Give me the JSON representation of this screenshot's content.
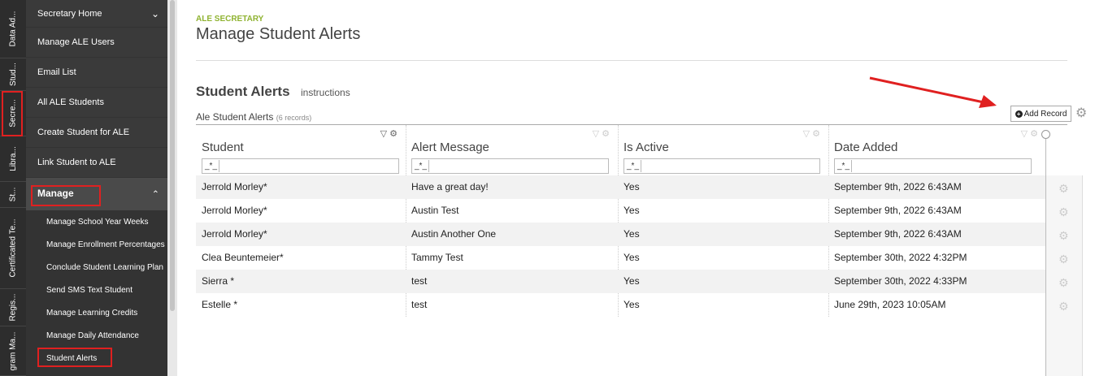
{
  "rail": {
    "tabs": [
      "Data Ad...",
      "Stud...",
      "Secre...",
      "Libra...",
      "St...",
      "Certificated Te...",
      "Regis...",
      "gram Ma..."
    ]
  },
  "sidebar": {
    "items": [
      {
        "label": "Secretary Home",
        "chevron": "chevron-down"
      },
      {
        "label": "Manage ALE Users"
      },
      {
        "label": "Email List"
      },
      {
        "label": "All ALE Students"
      },
      {
        "label": "Create Student for ALE"
      },
      {
        "label": "Link Student to ALE"
      }
    ],
    "manage": {
      "label": "Manage",
      "chevron": "chevron-up"
    },
    "sub_items": [
      "Manage School Year Weeks",
      "Manage Enrollment Percentages",
      "Conclude Student Learning Plan",
      "Send SMS Text Student",
      "Manage Learning Credits",
      "Manage Daily Attendance",
      "Student Alerts"
    ]
  },
  "header": {
    "eyebrow": "ALE SECRETARY",
    "title": "Manage Student Alerts"
  },
  "section": {
    "title": "Student Alerts",
    "instructions": "instructions"
  },
  "table": {
    "title": "Ale Student Alerts",
    "count": "(6 records)",
    "add_label": "Add Record",
    "filter_op": "_*_",
    "columns": [
      "Student",
      "Alert Message",
      "Is Active",
      "Date Added"
    ],
    "rows": [
      [
        "Jerrold Morley*",
        "Have a great day!",
        "Yes",
        "September 9th, 2022 6:43AM"
      ],
      [
        "Jerrold Morley*",
        "Austin Test",
        "Yes",
        "September 9th, 2022 6:43AM"
      ],
      [
        "Jerrold Morley*",
        "Austin Another One",
        "Yes",
        "September 9th, 2022 6:43AM"
      ],
      [
        "Clea Beuntemeier*",
        "Tammy Test",
        "Yes",
        "September 30th, 2022 4:32PM"
      ],
      [
        "Sierra *",
        "test",
        "Yes",
        "September 30th, 2022 4:33PM"
      ],
      [
        "Estelle *",
        "test",
        "Yes",
        "June 29th, 2023 10:05AM"
      ]
    ]
  },
  "colors": {
    "accent": "#8fb331",
    "highlight": "#e02020",
    "sidebar_bg": "#3a3a3a"
  }
}
